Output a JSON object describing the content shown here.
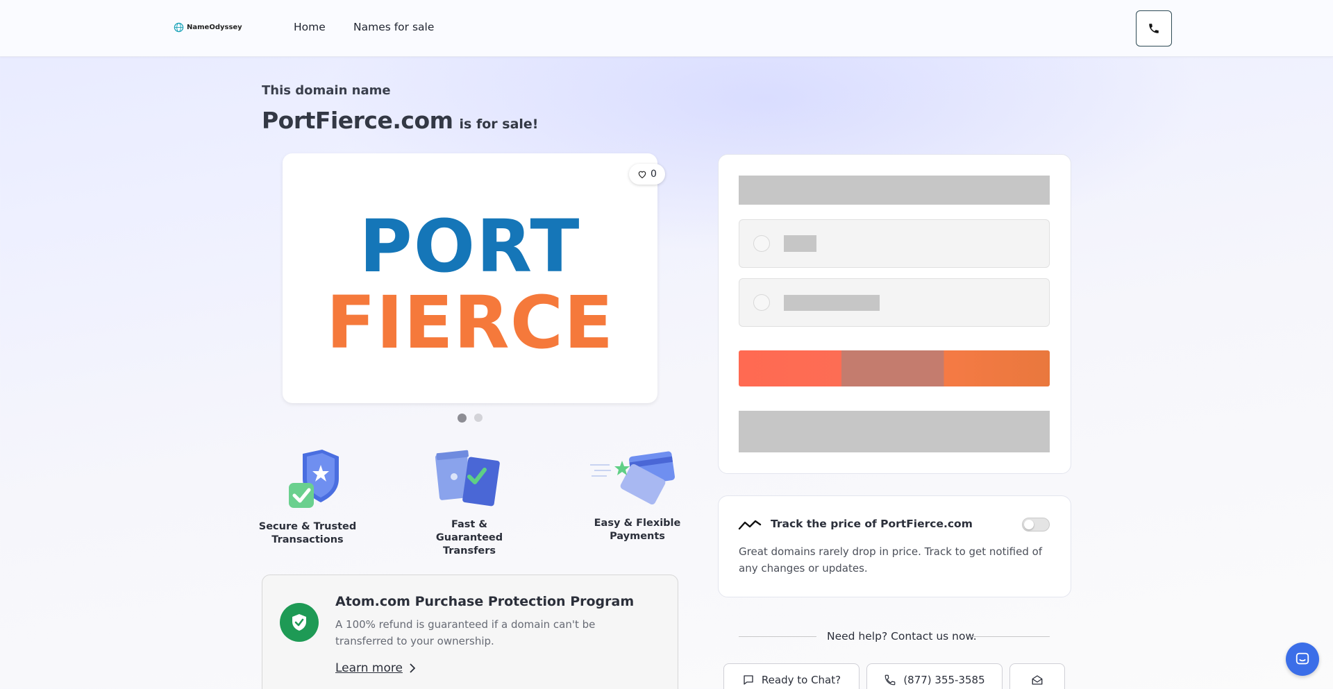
{
  "header": {
    "brand": "NameOdyssey",
    "nav": [
      "Home",
      "Names for sale"
    ]
  },
  "hero": {
    "subtitle": "This domain name",
    "domain": "PortFierce.com",
    "suffix": "is for sale!"
  },
  "logo_card": {
    "logo_line1": "PORT",
    "logo_line2": "FIERCE",
    "likes": "0",
    "slides": 2,
    "active_slide": 0
  },
  "features": [
    {
      "label_l1": "Secure & Trusted",
      "label_l2": "Transactions"
    },
    {
      "label_l1": "Fast & Guaranteed",
      "label_l2": "Transfers"
    },
    {
      "label_l1": "Easy & Flexible",
      "label_l2": "Payments"
    }
  ],
  "protection": {
    "title": "Atom.com Purchase Protection Program",
    "text": "A 100% refund is guaranteed if a domain can't be transferred to your ownership.",
    "link": "Learn more"
  },
  "track": {
    "title": "Track the price of PortFierce.com",
    "text": "Great domains rarely drop in price. Track to get notified of any changes or updates.",
    "enabled": false
  },
  "contact": {
    "heading": "Need help? Contact us now.",
    "chat": "Ready to Chat?",
    "phone": "(877) 355-3585"
  },
  "colors": {
    "logo_blue": "#1576b8",
    "logo_orange": "#f5793b",
    "protect_green": "#1e9a55",
    "chat_blue": "#3b6ee8"
  }
}
